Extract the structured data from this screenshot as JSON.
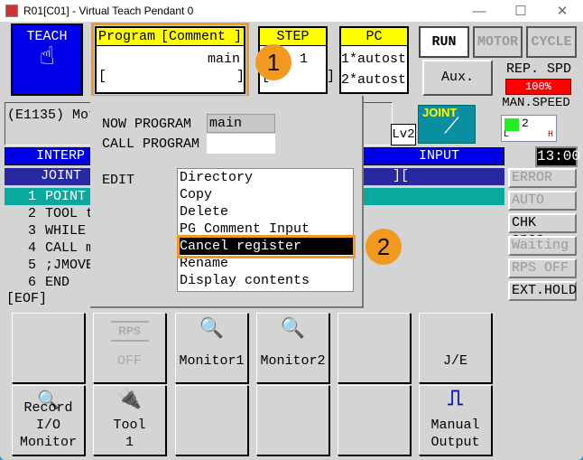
{
  "window": {
    "title": "R01[C01] - Virtual Teach Pendant 0",
    "minimize": "—",
    "maximize": "☐",
    "close": "✕"
  },
  "mode": {
    "label": "TEACH",
    "icon": "hand-pointer-icon"
  },
  "program_box": {
    "header_left": "Program",
    "header_right": "[Comment ]",
    "value": "main",
    "comment": "[                ]"
  },
  "step_box": {
    "header": "STEP",
    "value": "1",
    "comment": "[       ]"
  },
  "pc_box": {
    "header": "PC",
    "line1": "1*autost",
    "line2": "2*autost"
  },
  "status_buttons": {
    "run": "RUN",
    "motor": "MOTOR",
    "cycle": "CYCLE",
    "aux": "Aux."
  },
  "rep_speed": {
    "label": "REP. SPD",
    "value": "100%",
    "color": "#ff0000"
  },
  "man_speed": {
    "label": "MAN.SPEED",
    "level": "2",
    "low": "L",
    "high": "H"
  },
  "message": "(E1135) Moto",
  "level": "Lv2",
  "joint_icon": {
    "label": "JOINT"
  },
  "clock": "13:00",
  "bars": {
    "interp": "INTERP S",
    "input": "INPUT",
    "joint": "JOINT",
    "input_field": "][                    ]"
  },
  "program_lines": [
    {
      "num": "1",
      "text": "POINT"
    },
    {
      "num": "2",
      "text": "TOOL t"
    },
    {
      "num": "3",
      "text": "WHILE"
    },
    {
      "num": "4",
      "text": "CALL m"
    },
    {
      "num": "5",
      "text": ";JMOVE"
    },
    {
      "num": "6",
      "text": "END"
    }
  ],
  "eof": "[EOF]",
  "side_buttons": [
    "ERROR",
    "AUTO",
    "CHK once",
    "Waiting",
    "RPS OFF",
    "EXT.HOLD"
  ],
  "popup": {
    "now_program_label": "NOW PROGRAM",
    "now_program_value": "main",
    "call_program_label": "CALL PROGRAM",
    "call_program_value": "",
    "edit_label": "EDIT",
    "edit_items": [
      "Directory",
      "Copy",
      "Delete",
      "PG Comment Input",
      "Cancel register",
      "Rename",
      "Display contents"
    ],
    "selected": "Cancel register"
  },
  "function_keys": {
    "row1": [
      {
        "label": ""
      },
      {
        "icon_text": "RPS",
        "label": "OFF"
      },
      {
        "label": "Monitor1"
      },
      {
        "label": "Monitor2"
      },
      {
        "label": ""
      },
      {
        "label": "J/E"
      }
    ],
    "row2": [
      {
        "label1": "Record I/O",
        "label2": "Monitor"
      },
      {
        "label1": "Tool",
        "label2": "1"
      },
      {
        "label1": "",
        "label2": ""
      },
      {
        "label1": "",
        "label2": ""
      },
      {
        "label1": "",
        "label2": ""
      },
      {
        "label1": "Manual",
        "label2": "Output"
      }
    ]
  },
  "annotations": {
    "badge1": "1",
    "badge2": "2",
    "highlight_color": "#f29a1f"
  }
}
